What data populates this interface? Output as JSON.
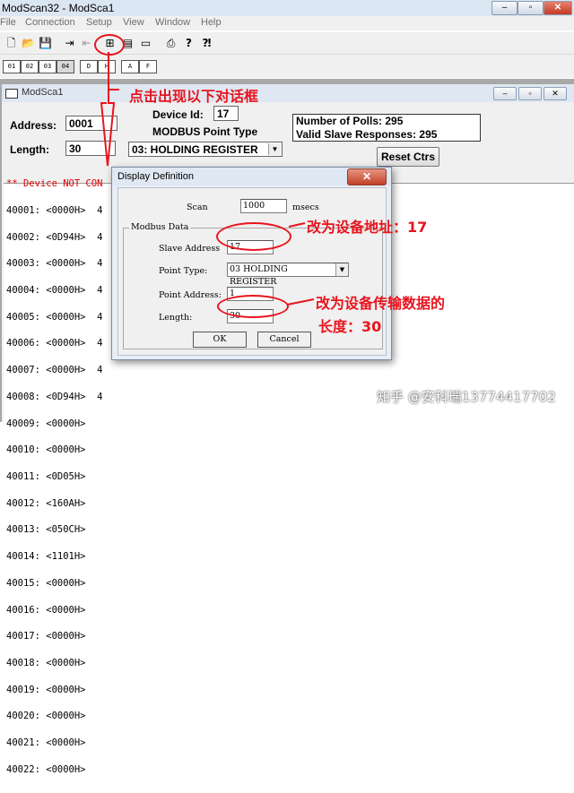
{
  "app": {
    "title": "ModScan32 - ModSca1",
    "window_buttons": [
      "–",
      "▫",
      "✕"
    ]
  },
  "menu": [
    "File",
    "Connection",
    "Setup",
    "View",
    "Window",
    "Help"
  ],
  "toolbar": {
    "row1_icons": [
      "new-document-icon",
      "open-folder-icon",
      "save-icon",
      "connect-icon",
      "disconnect-icon",
      "display-definition-icon",
      "chart-icon",
      "window-icon",
      "print-icon",
      "help-icon",
      "context-help-icon"
    ],
    "row2_icons": [
      "coil-status-icon",
      "input-status-icon",
      "holding-register-icon",
      "input-register-icon",
      "decimal-icon",
      "hex-icon",
      "ascii-icon",
      "float-icon"
    ]
  },
  "child_window": {
    "title": "ModSca1",
    "address_label": "Address:",
    "address_value": "0001",
    "length_label": "Length:",
    "length_value": "30",
    "device_id_label": "Device Id:",
    "device_id_value": "17",
    "point_type_label": "MODBUS Point Type",
    "point_type_value": "03: HOLDING REGISTER",
    "polls_text": "Number of Polls: 295",
    "responses_text": "Valid Slave Responses: 295",
    "reset_label": "Reset Ctrs",
    "status_text": "** Device NOT CON",
    "registers": [
      "40001: <0000H>  4",
      "40002: <0D94H>  4",
      "40003: <0000H>  4",
      "40004: <0000H>  4",
      "40005: <0000H>  4",
      "40006: <0000H>  4",
      "40007: <0000H>  4",
      "40008: <0D94H>  4",
      "40009: <0000H>",
      "40010: <0000H>",
      "40011: <0D05H>",
      "40012: <160AH>",
      "40013: <050CH>",
      "40014: <1101H>",
      "40015: <0000H>",
      "40016: <0000H>",
      "40017: <0000H>",
      "40018: <0000H>",
      "40019: <0000H>",
      "40020: <0000H>",
      "40021: <0000H>",
      "40022: <0000H>"
    ]
  },
  "dialog": {
    "title": "Display Definition",
    "close_label": "✕",
    "scan_label": "Scan",
    "scan_value": "1000",
    "scan_unit": "msecs",
    "group_label": "Modbus Data",
    "slave_label": "Slave Address",
    "slave_value": "17",
    "point_type_label": "Point Type:",
    "point_type_value": "03 HOLDING REGISTER",
    "point_address_label": "Point Address:",
    "point_address_value": "1",
    "length_label": "Length:",
    "length_value": "30",
    "ok_label": "OK",
    "cancel_label": "Cancel"
  },
  "annotations": {
    "top": "点击出现以下对话框",
    "slave": "改为设备地址：17",
    "length_line1": "改为设备传输数据的",
    "length_line2": "长度：30"
  },
  "watermark": "知乎 @安科瑞13774417702",
  "colors": {
    "annotation_red": "#e8141e",
    "status_red": "#e00000"
  }
}
